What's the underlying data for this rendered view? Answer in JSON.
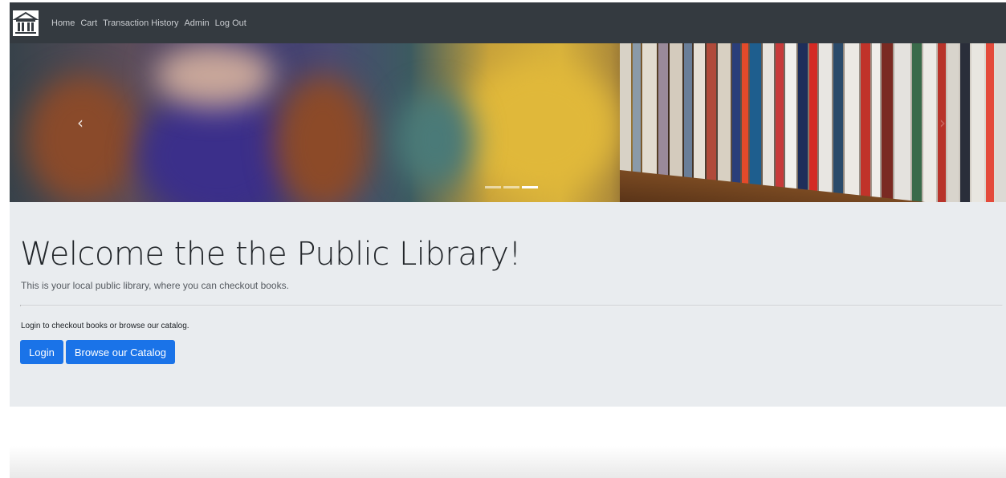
{
  "navbar": {
    "brand_icon": "library-building-icon",
    "links": [
      {
        "label": "Home"
      },
      {
        "label": "Cart"
      },
      {
        "label": "Transaction History"
      },
      {
        "label": "Admin"
      },
      {
        "label": "Log Out"
      }
    ]
  },
  "carousel": {
    "prev_icon": "chevron-left-icon",
    "next_icon": "chevron-right-icon",
    "slide_count": 3,
    "active_slide": 3
  },
  "jumbotron": {
    "title": "Welcome the the Public Library!",
    "lead": "This is your local public library, where you can checkout books.",
    "prompt": "Login to checkout books or browse our catalog.",
    "login_label": "Login",
    "browse_label": "Browse our Catalog"
  },
  "colors": {
    "navbar_bg": "#343a40",
    "jumbotron_bg": "#e9ecef",
    "primary": "#1a73e8"
  }
}
